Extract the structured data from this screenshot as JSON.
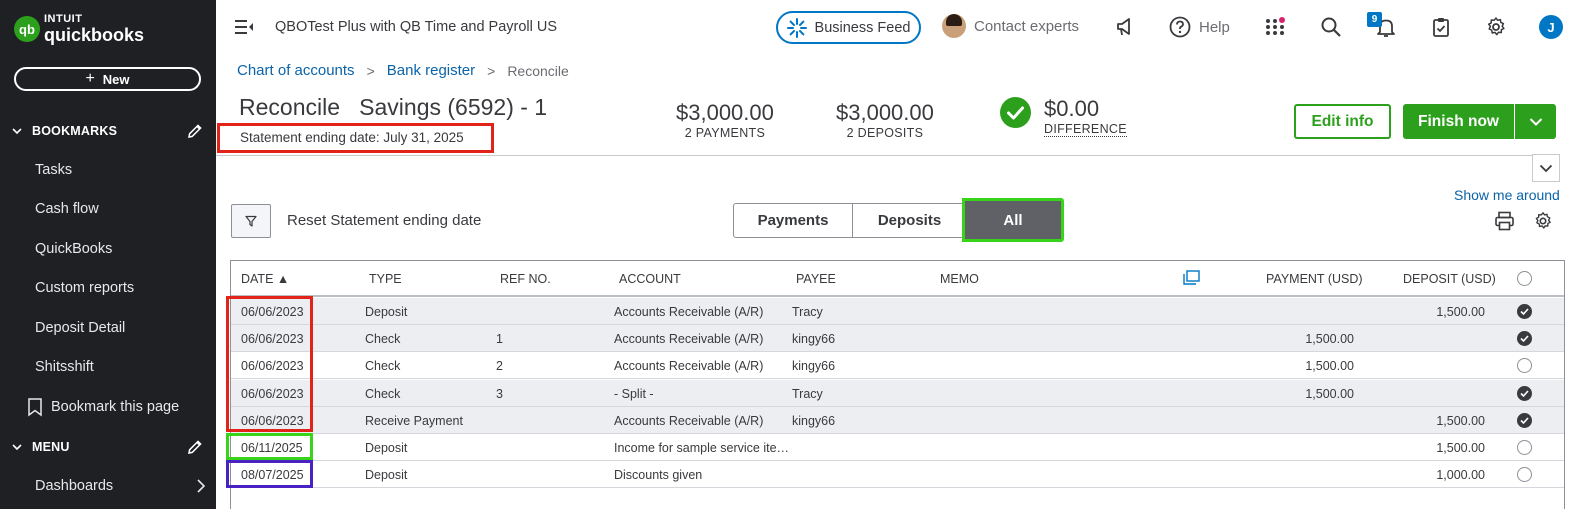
{
  "sidebar": {
    "logo_line1": "INTUIT",
    "logo_line2": "quickbooks",
    "logo_mark": "qb",
    "new_label": "New",
    "bookmarks_label": "BOOKMARKS",
    "bookmark_items": [
      "Tasks",
      "Cash flow",
      "QuickBooks",
      "Custom reports",
      "Deposit Detail",
      "Shitsshift"
    ],
    "bookmark_this_page": "Bookmark this page",
    "menu_label": "MENU",
    "menu_items": [
      "Dashboards"
    ]
  },
  "topbar": {
    "company": "QBOTest Plus with QB Time and Payroll US",
    "business_feed": "Business Feed",
    "contact_experts": "Contact experts",
    "help": "Help",
    "notification_count": "9",
    "avatar_initial": "J"
  },
  "breadcrumb": {
    "items": [
      "Chart of accounts",
      "Bank register"
    ],
    "current": "Reconcile"
  },
  "header": {
    "title": "Reconcile   Savings (6592) - 1",
    "statement_ending_date": "Statement ending date: July 31, 2025",
    "payments_amount": "$3,000.00",
    "payments_label": "2 PAYMENTS",
    "deposits_amount": "$3,000.00",
    "deposits_label": "2 DEPOSITS",
    "difference_amount": "$0.00",
    "difference_label": "DIFFERENCE",
    "edit_info": "Edit info",
    "finish_now": "Finish now",
    "show_me_around": "Show me around"
  },
  "filter": {
    "reset_label": "Reset Statement ending date",
    "segments": [
      "Payments",
      "Deposits",
      "All"
    ],
    "active_segment": "All"
  },
  "table": {
    "columns": {
      "date": "DATE ▲",
      "type": "TYPE",
      "ref": "REF NO.",
      "account": "ACCOUNT",
      "payee": "PAYEE",
      "memo": "MEMO",
      "payment": "PAYMENT (USD)",
      "deposit": "DEPOSIT (USD)"
    },
    "rows": [
      {
        "date": "06/06/2023",
        "type": "Deposit",
        "ref": "",
        "account": "Accounts Receivable (A/R)",
        "payee": "Tracy",
        "memo": "",
        "payment": "",
        "deposit": "1,500.00",
        "cleared": true
      },
      {
        "date": "06/06/2023",
        "type": "Check",
        "ref": "1",
        "account": "Accounts Receivable (A/R)",
        "payee": "kingy66",
        "memo": "",
        "payment": "1,500.00",
        "deposit": "",
        "cleared": true
      },
      {
        "date": "06/06/2023",
        "type": "Check",
        "ref": "2",
        "account": "Accounts Receivable (A/R)",
        "payee": "kingy66",
        "memo": "",
        "payment": "1,500.00",
        "deposit": "",
        "cleared": false
      },
      {
        "date": "06/06/2023",
        "type": "Check",
        "ref": "3",
        "account": "- Split -",
        "payee": "Tracy",
        "memo": "",
        "payment": "1,500.00",
        "deposit": "",
        "cleared": true
      },
      {
        "date": "06/06/2023",
        "type": "Receive Payment",
        "ref": "",
        "account": "Accounts Receivable (A/R)",
        "payee": "kingy66",
        "memo": "",
        "payment": "",
        "deposit": "1,500.00",
        "cleared": true
      },
      {
        "date": "06/11/2025",
        "type": "Deposit",
        "ref": "",
        "account": "Income for sample service ite…",
        "payee": "",
        "memo": "",
        "payment": "",
        "deposit": "1,500.00",
        "cleared": false
      },
      {
        "date": "08/07/2025",
        "type": "Deposit",
        "ref": "",
        "account": "Discounts given",
        "payee": "",
        "memo": "",
        "payment": "",
        "deposit": "1,000.00",
        "cleared": false
      }
    ]
  },
  "colors": {
    "brand_green": "#2ca01c",
    "link_blue": "#0b63a8",
    "sidebar_bg": "#1f2024",
    "highlight_red": "#e2231a",
    "highlight_green": "#38d41a",
    "highlight_purple": "#4a22c4"
  }
}
